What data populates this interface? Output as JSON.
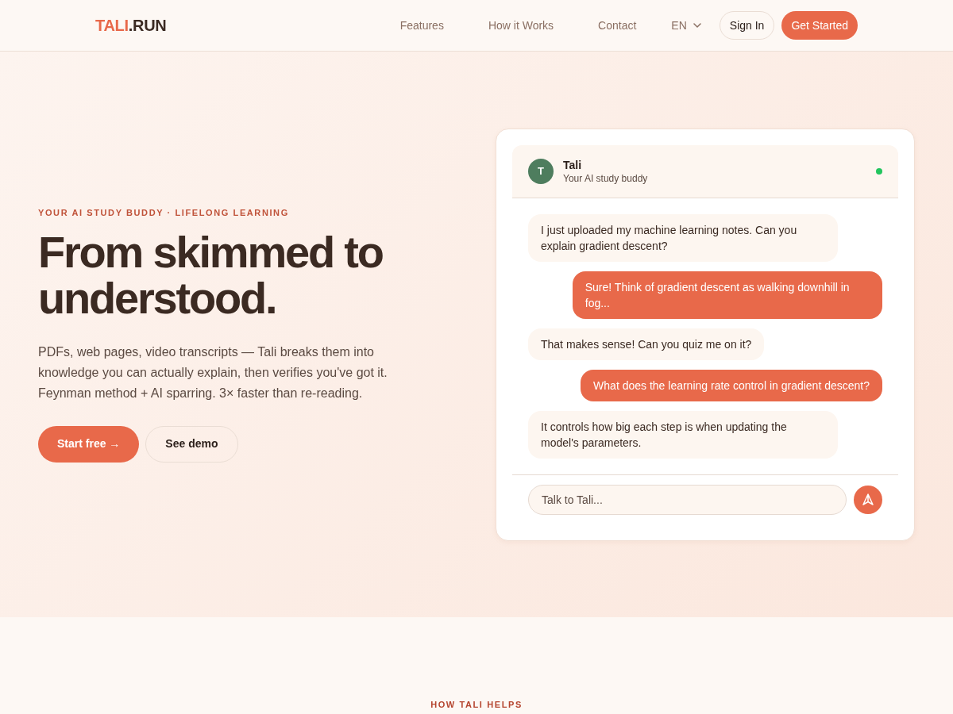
{
  "navbar": {
    "logo": {
      "name": "TALI",
      "suffix": ".RUN"
    },
    "links": [
      "Features",
      "How it Works",
      "Contact"
    ],
    "language": "EN",
    "sign_in": "Sign In",
    "cta": "Get Started"
  },
  "hero": {
    "eyebrow": "YOUR AI STUDY BUDDY · LIFELONG LEARNING",
    "heading": "From skimmed to understood.",
    "description": "PDFs, web pages, video transcripts — Tali breaks them into knowledge you can actually explain, then verifies you've got it. Feynman method + AI sparring. 3× faster than re-reading.",
    "buttons": [
      {
        "label": "Start free →",
        "kind": "primary"
      },
      {
        "label": "See demo",
        "kind": "secondary"
      }
    ]
  },
  "chat": {
    "header": {
      "avatar": "T",
      "name": "Tali",
      "subtitle": "Your AI study buddy",
      "online": true
    },
    "messages": [
      {
        "kind": "received",
        "text": "I just uploaded my machine learning notes. Can you explain gradient descent?"
      },
      {
        "kind": "sent",
        "text": "Sure! Think of gradient descent as walking downhill in fog..."
      },
      {
        "kind": "received",
        "text": "That makes sense! Can you quiz me on it?"
      },
      {
        "kind": "sent",
        "text": "What does the learning rate control in gradient descent?"
      },
      {
        "kind": "received",
        "text": "It controls how big each step is when updating the model's parameters."
      }
    ],
    "input": {
      "placeholder": "Talk to Tali..."
    }
  },
  "next_section": {
    "eyebrow": "HOW TALI HELPS"
  }
}
